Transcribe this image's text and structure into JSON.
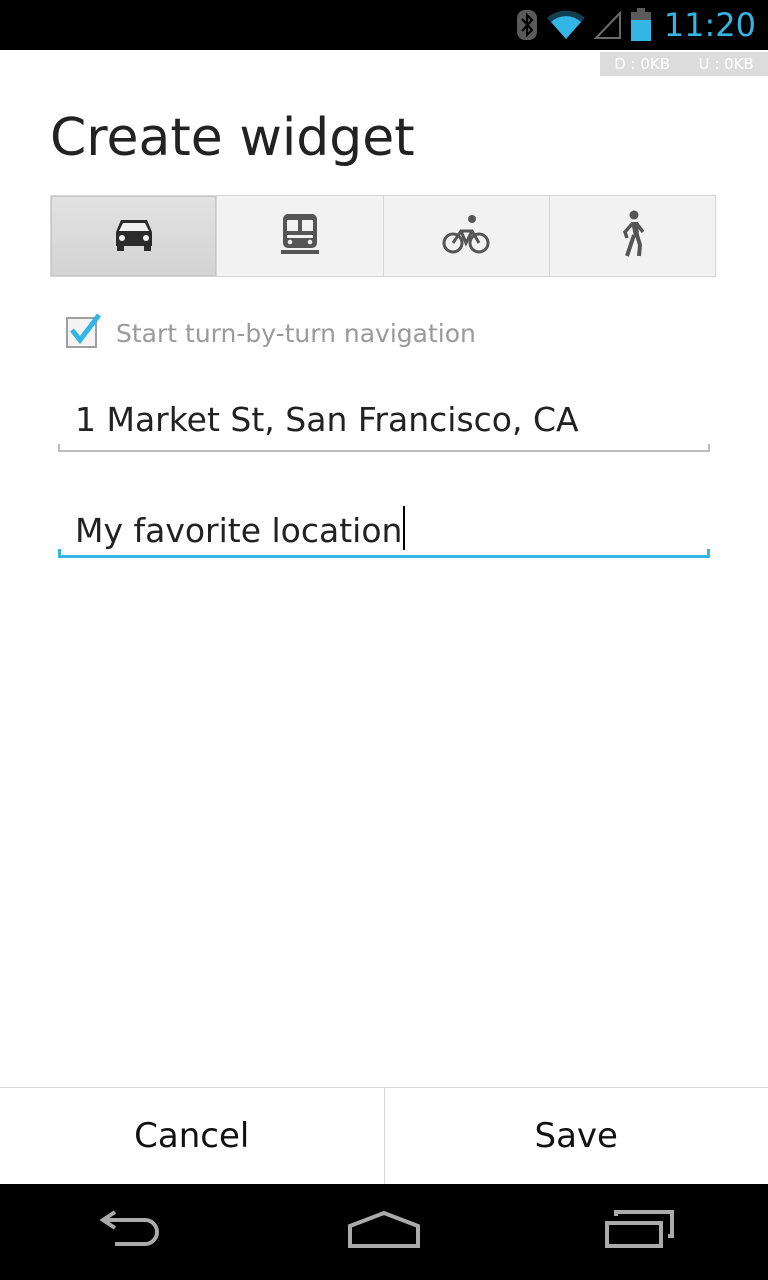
{
  "status_bar": {
    "time": "11:20",
    "icons": [
      "bluetooth-icon",
      "wifi-icon",
      "signal-icon",
      "battery-icon"
    ],
    "accent_color": "#33b5e5"
  },
  "data_indicator": {
    "download": "D : 0KB",
    "upload": "U : 0KB"
  },
  "page": {
    "title": "Create widget"
  },
  "modes": [
    {
      "icon": "car-icon",
      "selected": true
    },
    {
      "icon": "transit-icon",
      "selected": false
    },
    {
      "icon": "bicycle-icon",
      "selected": false
    },
    {
      "icon": "walking-icon",
      "selected": false
    }
  ],
  "navigation_checkbox": {
    "label": "Start turn-by-turn navigation",
    "checked": true
  },
  "fields": {
    "address": "1 Market St, San Francisco, CA",
    "name": "My favorite location"
  },
  "actions": {
    "cancel_label": "Cancel",
    "save_label": "Save"
  },
  "nav_bar": {
    "icons": [
      "back-icon",
      "home-icon",
      "recent-apps-icon"
    ]
  }
}
